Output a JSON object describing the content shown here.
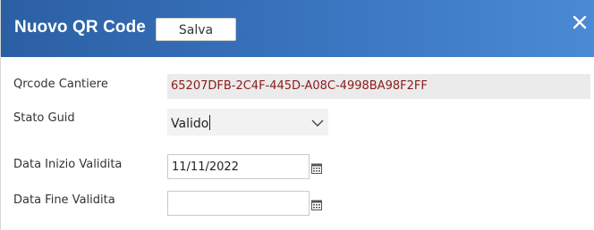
{
  "dialog": {
    "title": "Nuovo QR Code",
    "save_label": "Salva",
    "close_icon": "close-icon"
  },
  "form": {
    "qrcode_cantiere": {
      "label": "Qrcode Cantiere",
      "value": "65207DFB-2C4F-445D-A08C-4998BA98F2FF"
    },
    "stato_guid": {
      "label": "Stato Guid",
      "value": "Valido",
      "icon": "chevron-down-icon"
    },
    "data_inizio": {
      "label": "Data Inizio Validita",
      "value": "11/11/2022",
      "icon": "calendar-icon"
    },
    "data_fine": {
      "label": "Data Fine Validita",
      "value": "",
      "icon": "calendar-icon"
    }
  },
  "colors": {
    "header_start": "#2b5fa3",
    "header_end": "#4a8ad4",
    "readonly_text": "#8b1a1a",
    "readonly_bg": "#ebebeb"
  }
}
